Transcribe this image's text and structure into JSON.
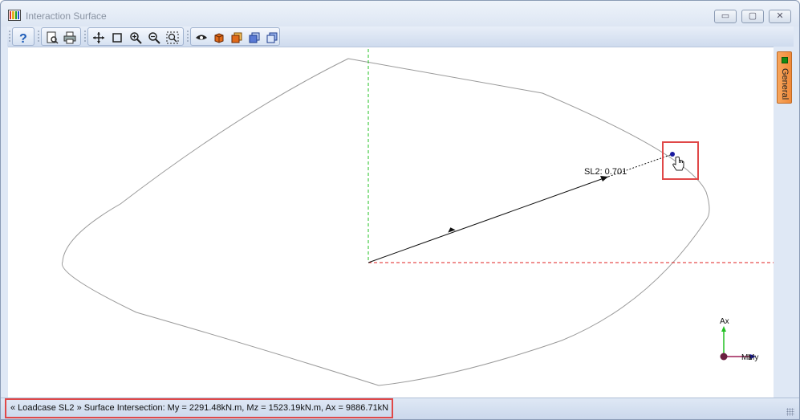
{
  "window": {
    "title": "Interaction Surface",
    "controls": {
      "minimize": "▭",
      "maximize": "▢",
      "close": "✕"
    }
  },
  "toolbar": {
    "groups": [
      {
        "name": "help",
        "buttons": [
          "help-icon"
        ]
      },
      {
        "name": "print",
        "buttons": [
          "print-preview-icon",
          "print-icon"
        ]
      },
      {
        "name": "view",
        "buttons": [
          "pan-icon",
          "zoom-window-icon",
          "zoom-in-icon",
          "zoom-out-icon",
          "zoom-extents-icon"
        ]
      },
      {
        "name": "render",
        "buttons": [
          "visibility-eye-icon",
          "solid-cube-icon",
          "cube-view-front-icon",
          "cube-view-side-icon",
          "cube-view-top-icon"
        ]
      }
    ]
  },
  "canvas": {
    "loadcase_label": "SL2: 0.701",
    "axis_labels": {
      "vertical": "Ax",
      "horizontal": "My",
      "depth": "Mz"
    },
    "colors": {
      "vertical_axis": "#22c022",
      "horizontal_axis": "#e02020",
      "depth_axis": "#1c1cc0",
      "surface_outline": "#9a9a9a",
      "vector": "#111111",
      "point": "#1a1aa0"
    }
  },
  "side_panel": {
    "tab_label": "General",
    "tab_color": "#f08a3a"
  },
  "status": {
    "text": "« Loadcase SL2 »  Surface Intersection: My = 2291.48kN.m, Mz = 1523.19kN.m, Ax = 9886.71kN"
  }
}
